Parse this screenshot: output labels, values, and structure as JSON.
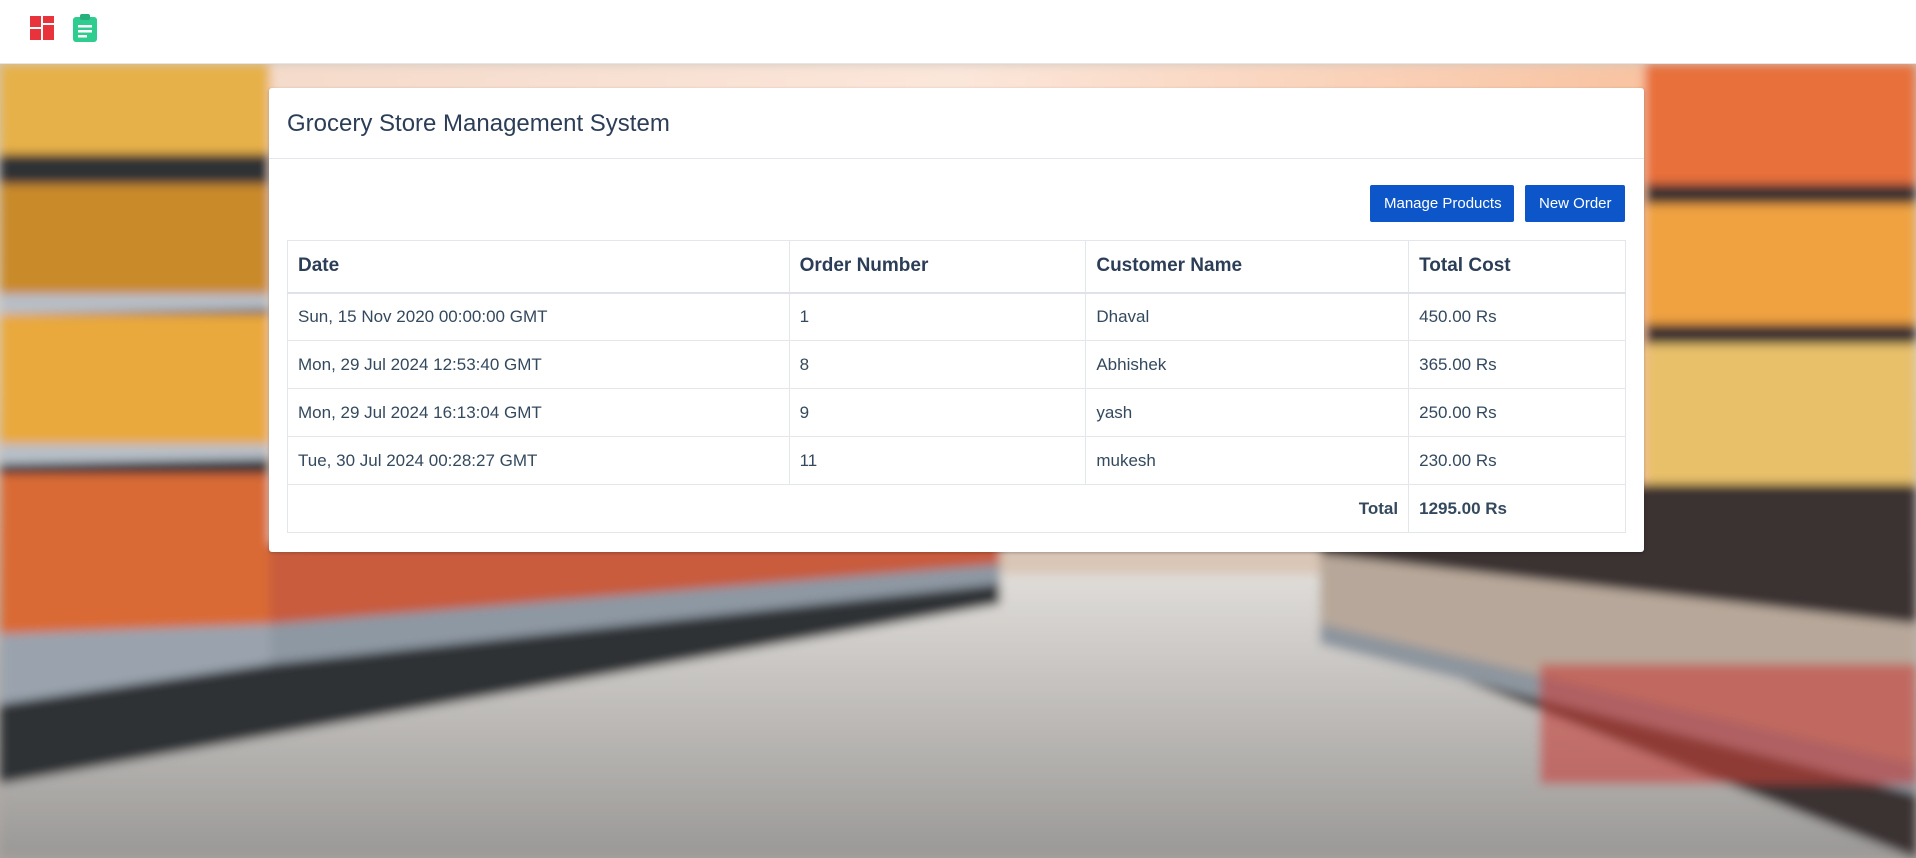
{
  "nav": {
    "logo_icon": "dashboard-grid-icon",
    "orders_icon": "clipboard-icon",
    "logo_color": "#e8323c",
    "orders_color": "#2ecc8f"
  },
  "panel": {
    "title": "Grocery Store Management System"
  },
  "actions": {
    "manage_products_label": "Manage Products",
    "new_order_label": "New Order",
    "button_color": "#0c56c9"
  },
  "table": {
    "headers": {
      "date": "Date",
      "order_number": "Order Number",
      "customer_name": "Customer Name",
      "total_cost": "Total Cost"
    },
    "rows": [
      {
        "date": "Sun, 15 Nov 2020 00:00:00 GMT",
        "order_number": "1",
        "customer_name": "Dhaval",
        "total_cost": "450.00 Rs"
      },
      {
        "date": "Mon, 29 Jul 2024 12:53:40 GMT",
        "order_number": "8",
        "customer_name": "Abhishek",
        "total_cost": "365.00 Rs"
      },
      {
        "date": "Mon, 29 Jul 2024 16:13:04 GMT",
        "order_number": "9",
        "customer_name": "yash",
        "total_cost": "250.00 Rs"
      },
      {
        "date": "Tue, 30 Jul 2024 00:28:27 GMT",
        "order_number": "11",
        "customer_name": "mukesh",
        "total_cost": "230.00 Rs"
      }
    ],
    "total_label": "Total",
    "total_value": "1295.00 Rs"
  }
}
